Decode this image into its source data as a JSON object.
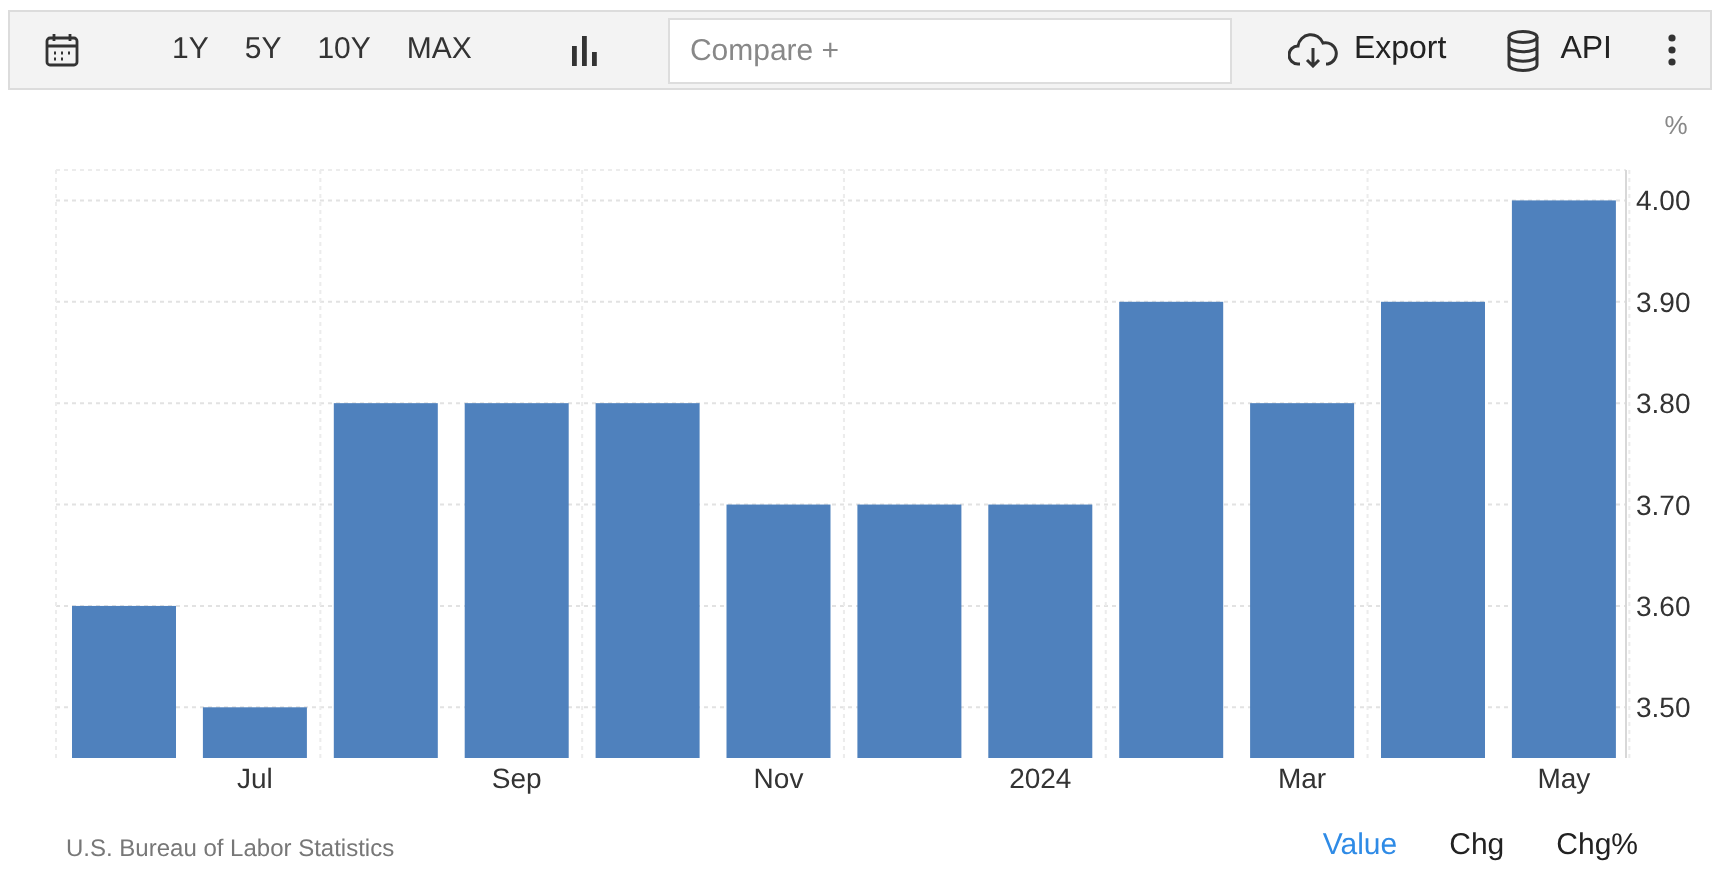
{
  "toolbar": {
    "ranges": [
      "1Y",
      "5Y",
      "10Y",
      "MAX"
    ],
    "compare": {
      "placeholder": "Compare +"
    },
    "export": "Export",
    "api": "API"
  },
  "chart": {
    "chart_data": {
      "type": "bar",
      "ylabel": "%",
      "grid": true,
      "categories": [
        null,
        "Jul",
        null,
        "Sep",
        null,
        "Nov",
        null,
        "2024",
        null,
        "Mar",
        null,
        "May"
      ],
      "values": [
        3.6,
        3.5,
        3.8,
        3.8,
        3.8,
        3.7,
        3.7,
        3.7,
        3.9,
        3.8,
        3.9,
        4.0
      ],
      "ylim": [
        3.45,
        4.03
      ],
      "yticks": [
        {
          "value": 3.5,
          "label": "3.50"
        },
        {
          "value": 3.6,
          "label": "3.60"
        },
        {
          "value": 3.7,
          "label": "3.70"
        },
        {
          "value": 3.8,
          "label": "3.80"
        },
        {
          "value": 3.9,
          "label": "3.90"
        },
        {
          "value": 4.0,
          "label": "4.00"
        }
      ]
    }
  },
  "footer": {
    "source": "U.S. Bureau of Labor Statistics",
    "views": [
      {
        "label": "Value",
        "selected": true
      },
      {
        "label": "Chg",
        "selected": false
      },
      {
        "label": "Chg%",
        "selected": false
      }
    ]
  }
}
